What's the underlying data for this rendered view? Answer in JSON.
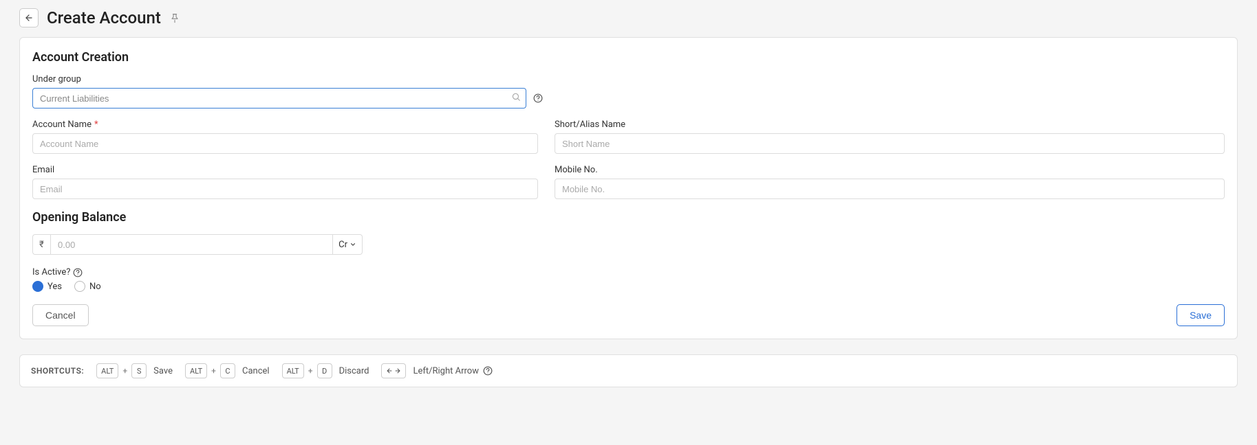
{
  "header": {
    "title": "Create Account"
  },
  "section1": {
    "title": "Account Creation",
    "under_group": {
      "label": "Under group",
      "value": "Current Liabilities"
    },
    "account_name": {
      "label": "Account Name",
      "placeholder": "Account Name"
    },
    "short_name": {
      "label": "Short/Alias Name",
      "placeholder": "Short Name"
    },
    "email": {
      "label": "Email",
      "placeholder": "Email"
    },
    "mobile": {
      "label": "Mobile No.",
      "placeholder": "Mobile No."
    }
  },
  "section2": {
    "title": "Opening Balance",
    "currency_symbol": "₹",
    "placeholder": "0.00",
    "crdr": "Cr"
  },
  "is_active": {
    "label": "Is Active?",
    "yes": "Yes",
    "no": "No"
  },
  "buttons": {
    "cancel": "Cancel",
    "save": "Save"
  },
  "shortcuts": {
    "label": "SHORTCUTS:",
    "items": [
      {
        "keys": [
          "ALT",
          "S"
        ],
        "action": "Save"
      },
      {
        "keys": [
          "ALT",
          "C"
        ],
        "action": "Cancel"
      },
      {
        "keys": [
          "ALT",
          "D"
        ],
        "action": "Discard"
      }
    ],
    "arrow_action": "Left/Right Arrow"
  }
}
